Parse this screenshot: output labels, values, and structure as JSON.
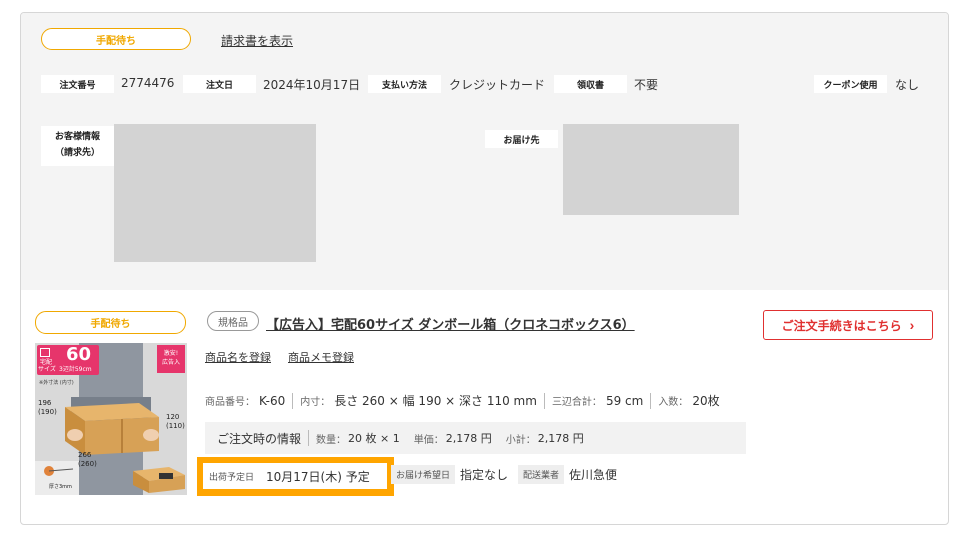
{
  "order": {
    "status_badge": "手配待ち",
    "invoice_link": "請求書を表示",
    "order_number_label": "注文番号",
    "order_number": "2774476",
    "order_date_label": "注文日",
    "order_date": "2024年10月17日",
    "payment_label": "支払い方法",
    "payment": "クレジットカード",
    "receipt_label": "領収書",
    "receipt": "不要",
    "coupon_label": "クーポン使用",
    "coupon": "なし",
    "customer_label_1": "お客様情報",
    "customer_label_2": "（請求先）",
    "delivery_label": "お届け先"
  },
  "item": {
    "status_badge": "手配待ち",
    "spec_tag": "規格品",
    "name": "【広告入】宅配60サイズ ダンボール箱（クロネコボックス6）",
    "order_button": "ご注文手続きはこちら",
    "order_button_chevron": "›",
    "link_name_register": "商品名を登録",
    "link_memo_register": "商品メモ登録",
    "code_label": "商品番号：",
    "code": "K-60",
    "inner_label": "内寸：",
    "inner": "長さ 260 × 幅 190 × 深さ 110 mm",
    "sum_label": "三辺合計：",
    "sum": "59 cm",
    "count_label": "入数：",
    "count": "20枚",
    "order_info_label": "ご注文時の情報",
    "qty_label": "数量：",
    "qty": "20 枚 × 1",
    "unit_label": "単価：",
    "unit": "2,178 円",
    "subtotal_label": "小計：",
    "subtotal": "2,178 円",
    "ship_date_label": "出荷予定日",
    "ship_date": "10月17日(木) 予定",
    "desired_label": "お届け希望日",
    "desired": "指定なし",
    "carrier_label": "配送業者",
    "carrier": "佐川急便"
  },
  "thumbnail": {
    "size_badge_top": "宅配",
    "size_badge_bottom": "サイズ",
    "size_number": "60",
    "sum_text": "3辺計59cm",
    "promo_1": "激安!",
    "promo_2": "広告入",
    "caption": "※外寸法 (内寸)",
    "dim_height": "196",
    "dim_height_inner": "(190)",
    "dim_length": "120",
    "dim_length_inner": "(110)",
    "dim_width": "266",
    "dim_width_inner": "(260)",
    "thickness": "厚さ3mm"
  },
  "colors": {
    "accent_orange": "#f0a800",
    "highlight": "#ffa500",
    "button_red": "#e03030"
  }
}
